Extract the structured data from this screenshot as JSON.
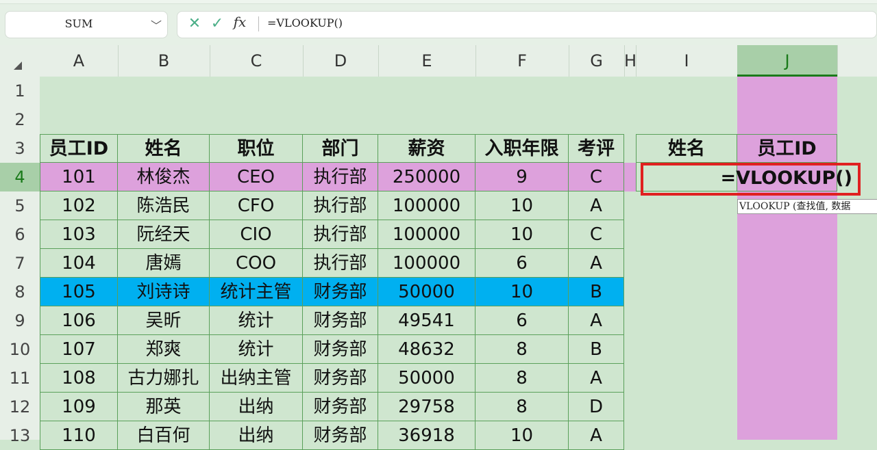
{
  "formula_bar": {
    "name_box": "SUM",
    "cancel_icon": "✕",
    "enter_icon": "✓",
    "fx_label": "fx",
    "content": "=VLOOKUP()"
  },
  "columns": [
    "A",
    "B",
    "C",
    "D",
    "E",
    "F",
    "G",
    "H",
    "I",
    "J"
  ],
  "rows": [
    "1",
    "2",
    "3",
    "4",
    "5",
    "6",
    "7",
    "8",
    "9",
    "10",
    "11",
    "12",
    "13"
  ],
  "table": {
    "headers": [
      "员工ID",
      "姓名",
      "职位",
      "部门",
      "薪资",
      "入职年限",
      "考评"
    ],
    "rows": [
      [
        "101",
        "林俊杰",
        "CEO",
        "执行部",
        "250000",
        "9",
        "C"
      ],
      [
        "102",
        "陈浩民",
        "CFO",
        "执行部",
        "100000",
        "10",
        "A"
      ],
      [
        "103",
        "阮经天",
        "CIO",
        "执行部",
        "100000",
        "10",
        "C"
      ],
      [
        "104",
        "唐嫣",
        "COO",
        "执行部",
        "100000",
        "6",
        "A"
      ],
      [
        "105",
        "刘诗诗",
        "统计主管",
        "财务部",
        "50000",
        "10",
        "B"
      ],
      [
        "106",
        "吴昕",
        "统计",
        "财务部",
        "49541",
        "6",
        "A"
      ],
      [
        "107",
        "郑爽",
        "统计",
        "财务部",
        "48632",
        "8",
        "B"
      ],
      [
        "108",
        "古力娜扎",
        "出纳主管",
        "财务部",
        "50000",
        "8",
        "A"
      ],
      [
        "109",
        "那英",
        "出纳",
        "财务部",
        "29758",
        "8",
        "D"
      ],
      [
        "110",
        "白百何",
        "出纳",
        "财务部",
        "36918",
        "10",
        "A"
      ]
    ]
  },
  "lookup": {
    "headers": [
      "姓名",
      "员工ID"
    ],
    "formula": "=VLOOKUP()"
  },
  "tooltip": "VLOOKUP (查找值, 数据",
  "colors": {
    "sheet_bg": "#cfe6cf",
    "highlight_pink": "#dda1dc",
    "highlight_blue": "#00b0f0",
    "selection_red": "#e02020"
  }
}
